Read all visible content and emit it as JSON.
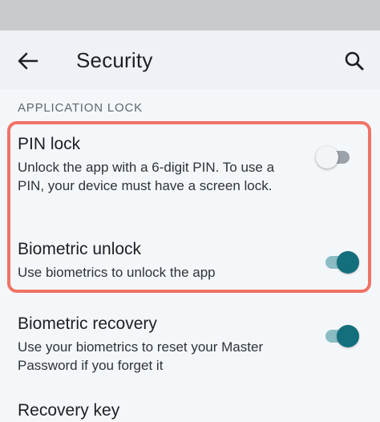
{
  "header": {
    "title": "Security",
    "back_icon": "arrow-left-icon",
    "search_icon": "search-icon"
  },
  "section": {
    "label": "APPLICATION LOCK"
  },
  "settings": [
    {
      "title": "PIN lock",
      "description": "Unlock the app with a 6-digit PIN. To use a PIN, your device must have a screen lock.",
      "enabled": false
    },
    {
      "title": "Biometric unlock",
      "description": "Use biometrics to unlock the app",
      "enabled": true
    },
    {
      "title": "Biometric recovery",
      "description": "Use your biometrics to reset your Master Password if you forget it",
      "enabled": true
    },
    {
      "title": "Recovery key",
      "description": ""
    }
  ],
  "colors": {
    "accent": "#136f7c",
    "highlight": "#ef7366"
  }
}
